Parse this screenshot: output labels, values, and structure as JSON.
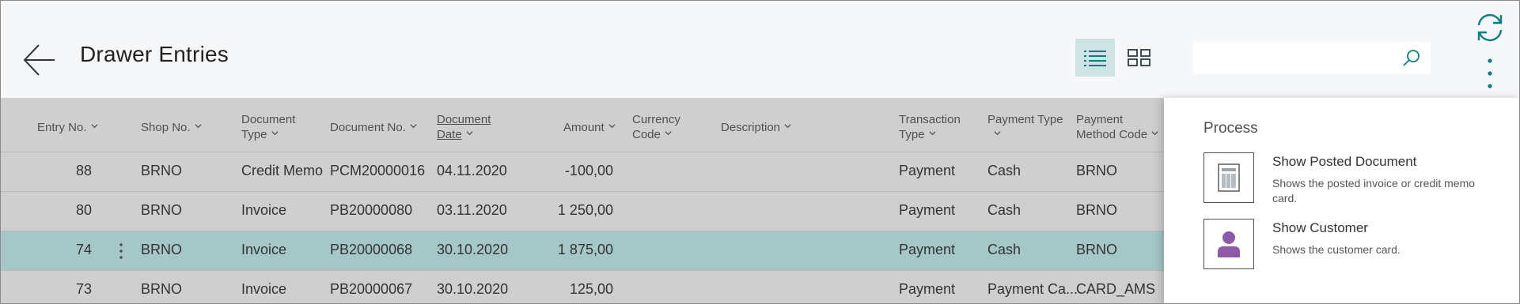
{
  "header": {
    "title": "Drawer Entries",
    "search_placeholder": ""
  },
  "colors": {
    "accent": "#0a7e82",
    "selected_row": "#a5c7c8",
    "grid_bg": "#cfcfcf",
    "header_bg": "#f6f7f9",
    "customer_icon": "#8e5aa8"
  },
  "columns": [
    {
      "line1": "Entry No.",
      "line2": ""
    },
    {
      "line1": "Shop No.",
      "line2": ""
    },
    {
      "line1": "Document",
      "line2": "Type"
    },
    {
      "line1": "Document No.",
      "line2": ""
    },
    {
      "line1": "Document",
      "line2": "Date"
    },
    {
      "line1": "Amount",
      "line2": ""
    },
    {
      "line1": "Currency",
      "line2": "Code"
    },
    {
      "line1": "Description",
      "line2": ""
    },
    {
      "line1": "Transaction",
      "line2": "Type"
    },
    {
      "line1": "Payment Type",
      "line2": ""
    },
    {
      "line1": "Payment",
      "line2": "Method Code"
    }
  ],
  "rows": [
    {
      "entry_no": "88",
      "shop_no": "BRNO",
      "doc_type": "Credit Memo",
      "doc_no": "PCM20000016",
      "doc_date": "04.11.2020",
      "amount": "-100,00",
      "currency": "",
      "description": "",
      "trans_type": "Payment",
      "pay_type": "Cash",
      "pay_method": "BRNO"
    },
    {
      "entry_no": "80",
      "shop_no": "BRNO",
      "doc_type": "Invoice",
      "doc_no": "PB20000080",
      "doc_date": "03.11.2020",
      "amount": "1 250,00",
      "currency": "",
      "description": "",
      "trans_type": "Payment",
      "pay_type": "Cash",
      "pay_method": "BRNO"
    },
    {
      "entry_no": "74",
      "shop_no": "BRNO",
      "doc_type": "Invoice",
      "doc_no": "PB20000068",
      "doc_date": "30.10.2020",
      "amount": "1 875,00",
      "currency": "",
      "description": "",
      "trans_type": "Payment",
      "pay_type": "Cash",
      "pay_method": "BRNO"
    },
    {
      "entry_no": "73",
      "shop_no": "BRNO",
      "doc_type": "Invoice",
      "doc_no": "PB20000067",
      "doc_date": "30.10.2020",
      "amount": "125,00",
      "currency": "",
      "description": "",
      "trans_type": "Payment",
      "pay_type": "Payment Ca...",
      "pay_method": "CARD_AMS"
    }
  ],
  "panel": {
    "title": "Process",
    "actions": [
      {
        "title": "Show Posted Document",
        "description": "Shows the posted invoice or credit memo card.",
        "icon": "posted-document-icon"
      },
      {
        "title": "Show Customer",
        "description": "Shows the customer card.",
        "icon": "customer-icon"
      }
    ]
  }
}
